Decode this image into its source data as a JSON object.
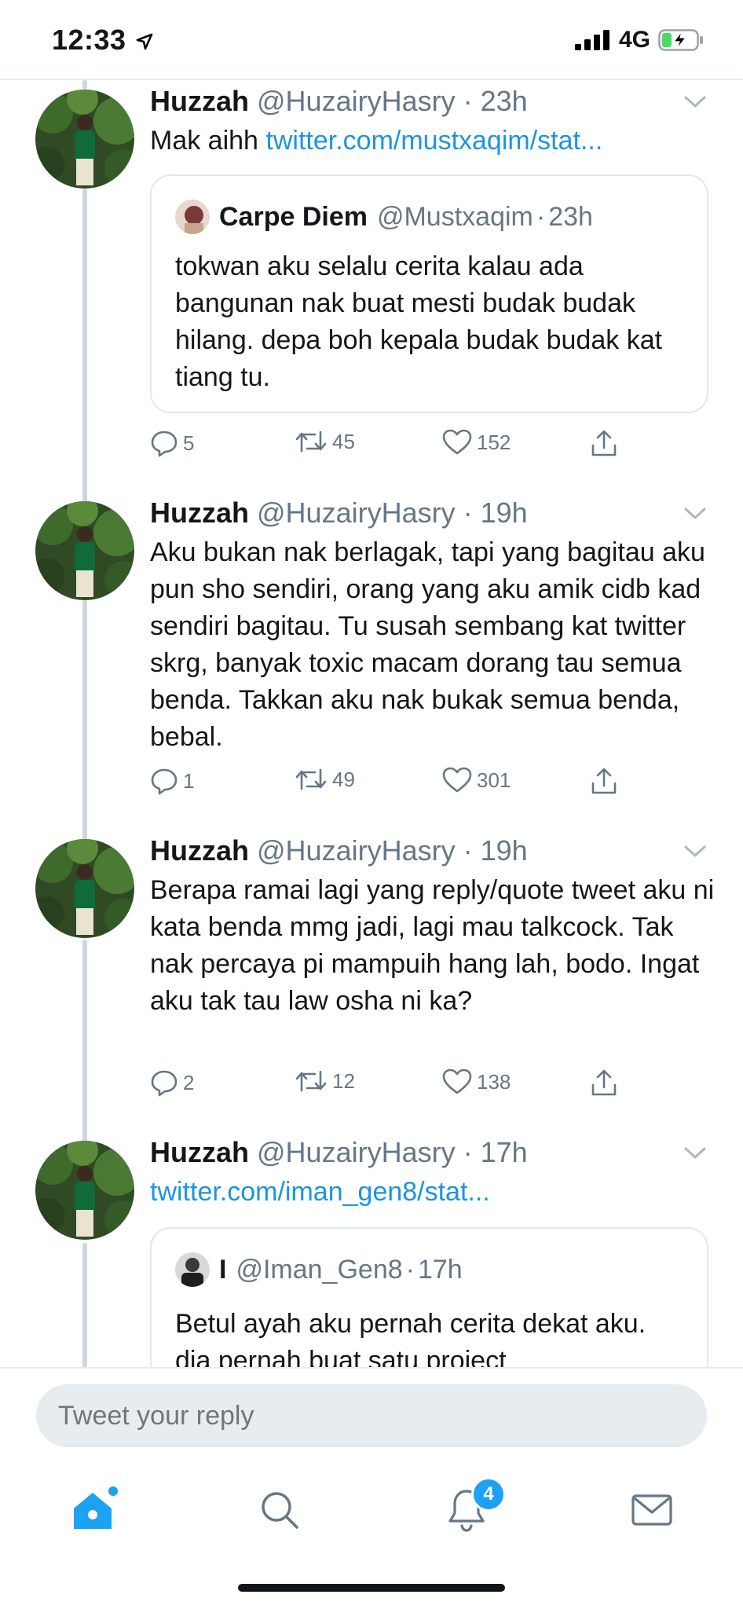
{
  "status_bar": {
    "time": "12:33",
    "network": "4G"
  },
  "tweets": [
    {
      "name": "Huzzah",
      "handle": "@HuzairyHasry",
      "sep": "·",
      "time": "23h",
      "text": "Mak aihh ",
      "link": "twitter.com/mustxaqim/stat...",
      "quote": {
        "name": "Carpe Diem",
        "handle": "@Mustxaqim",
        "time": "23h",
        "text": "tokwan aku selalu cerita kalau ada bangunan nak buat mesti budak budak hilang. depa boh kepala budak budak kat tiang tu."
      },
      "replies": "5",
      "retweets": "45",
      "likes": "152"
    },
    {
      "name": "Huzzah",
      "handle": "@HuzairyHasry",
      "sep": "·",
      "time": "19h",
      "text": "Aku bukan nak berlagak, tapi yang bagitau aku pun sho sendiri, orang yang aku amik cidb kad sendiri bagitau. Tu susah sembang kat twitter skrg, banyak toxic macam dorang tau semua benda. Takkan aku nak bukak semua benda, bebal.",
      "replies": "1",
      "retweets": "49",
      "likes": "301"
    },
    {
      "name": "Huzzah",
      "handle": "@HuzairyHasry",
      "sep": "·",
      "time": "19h",
      "text": "Berapa ramai lagi yang reply/quote tweet aku ni kata benda mmg jadi, lagi mau talkcock. Tak nak percaya pi mampuih hang lah, bodo. Ingat aku tak tau law osha ni ka?",
      "replies": "2",
      "retweets": "12",
      "likes": "138"
    },
    {
      "name": "Huzzah",
      "handle": "@HuzairyHasry",
      "sep": "·",
      "time": "17h",
      "link": "twitter.com/iman_gen8/stat...",
      "quote": {
        "name": "I",
        "handle": "@Iman_Gen8",
        "time": "17h",
        "text": "Betul ayah aku pernah cerita dekat aku. dia pernah buat satu project"
      }
    }
  ],
  "reply": {
    "placeholder": "Tweet your reply"
  },
  "tabs": {
    "items": [
      "home-icon",
      "search-icon",
      "notifications-icon",
      "messages-icon"
    ],
    "notifications_badge": "4"
  },
  "colors": {
    "accent": "#1da1f2",
    "link": "#1b95e0",
    "secondary_text": "#657786",
    "border": "#e1e8ed"
  }
}
